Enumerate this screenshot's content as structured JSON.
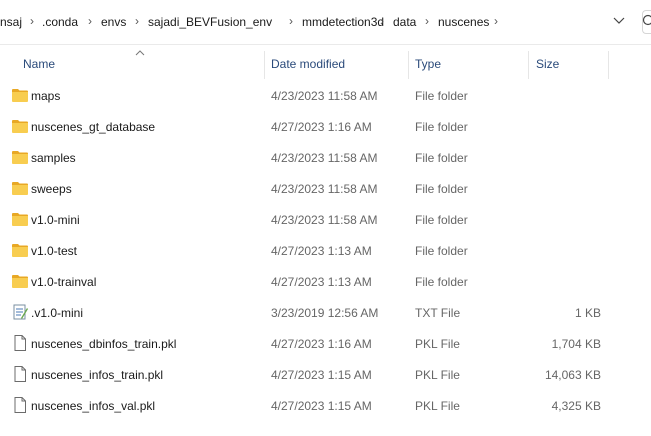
{
  "breadcrumb": {
    "items": [
      "nsaj",
      ".conda",
      "envs",
      "sajadi_BEVFusion_env",
      "mmdetection3d",
      "data",
      "nuscenes"
    ]
  },
  "columns": {
    "name": "Name",
    "date": "Date modified",
    "type": "Type",
    "size": "Size"
  },
  "files": [
    {
      "name": "maps",
      "date": "4/23/2023 11:58 AM",
      "type": "File folder",
      "size": "",
      "icon": "folder-icon"
    },
    {
      "name": "nuscenes_gt_database",
      "date": "4/27/2023 1:16 AM",
      "type": "File folder",
      "size": "",
      "icon": "folder-icon"
    },
    {
      "name": "samples",
      "date": "4/23/2023 11:58 AM",
      "type": "File folder",
      "size": "",
      "icon": "folder-icon"
    },
    {
      "name": "sweeps",
      "date": "4/23/2023 11:58 AM",
      "type": "File folder",
      "size": "",
      "icon": "folder-icon"
    },
    {
      "name": "v1.0-mini",
      "date": "4/23/2023 11:58 AM",
      "type": "File folder",
      "size": "",
      "icon": "folder-icon"
    },
    {
      "name": "v1.0-test",
      "date": "4/27/2023 1:13 AM",
      "type": "File folder",
      "size": "",
      "icon": "folder-icon"
    },
    {
      "name": "v1.0-trainval",
      "date": "4/27/2023 1:13 AM",
      "type": "File folder",
      "size": "",
      "icon": "folder-icon"
    },
    {
      "name": ".v1.0-mini",
      "date": "3/23/2019 12:56 AM",
      "type": "TXT File",
      "size": "1 KB",
      "icon": "text-file-icon"
    },
    {
      "name": "nuscenes_dbinfos_train.pkl",
      "date": "4/27/2023 1:16 AM",
      "type": "PKL File",
      "size": "1,704 KB",
      "icon": "file-icon"
    },
    {
      "name": "nuscenes_infos_train.pkl",
      "date": "4/27/2023 1:15 AM",
      "type": "PKL File",
      "size": "14,063 KB",
      "icon": "file-icon"
    },
    {
      "name": "nuscenes_infos_val.pkl",
      "date": "4/27/2023 1:15 AM",
      "type": "PKL File",
      "size": "4,325 KB",
      "icon": "file-icon"
    }
  ]
}
